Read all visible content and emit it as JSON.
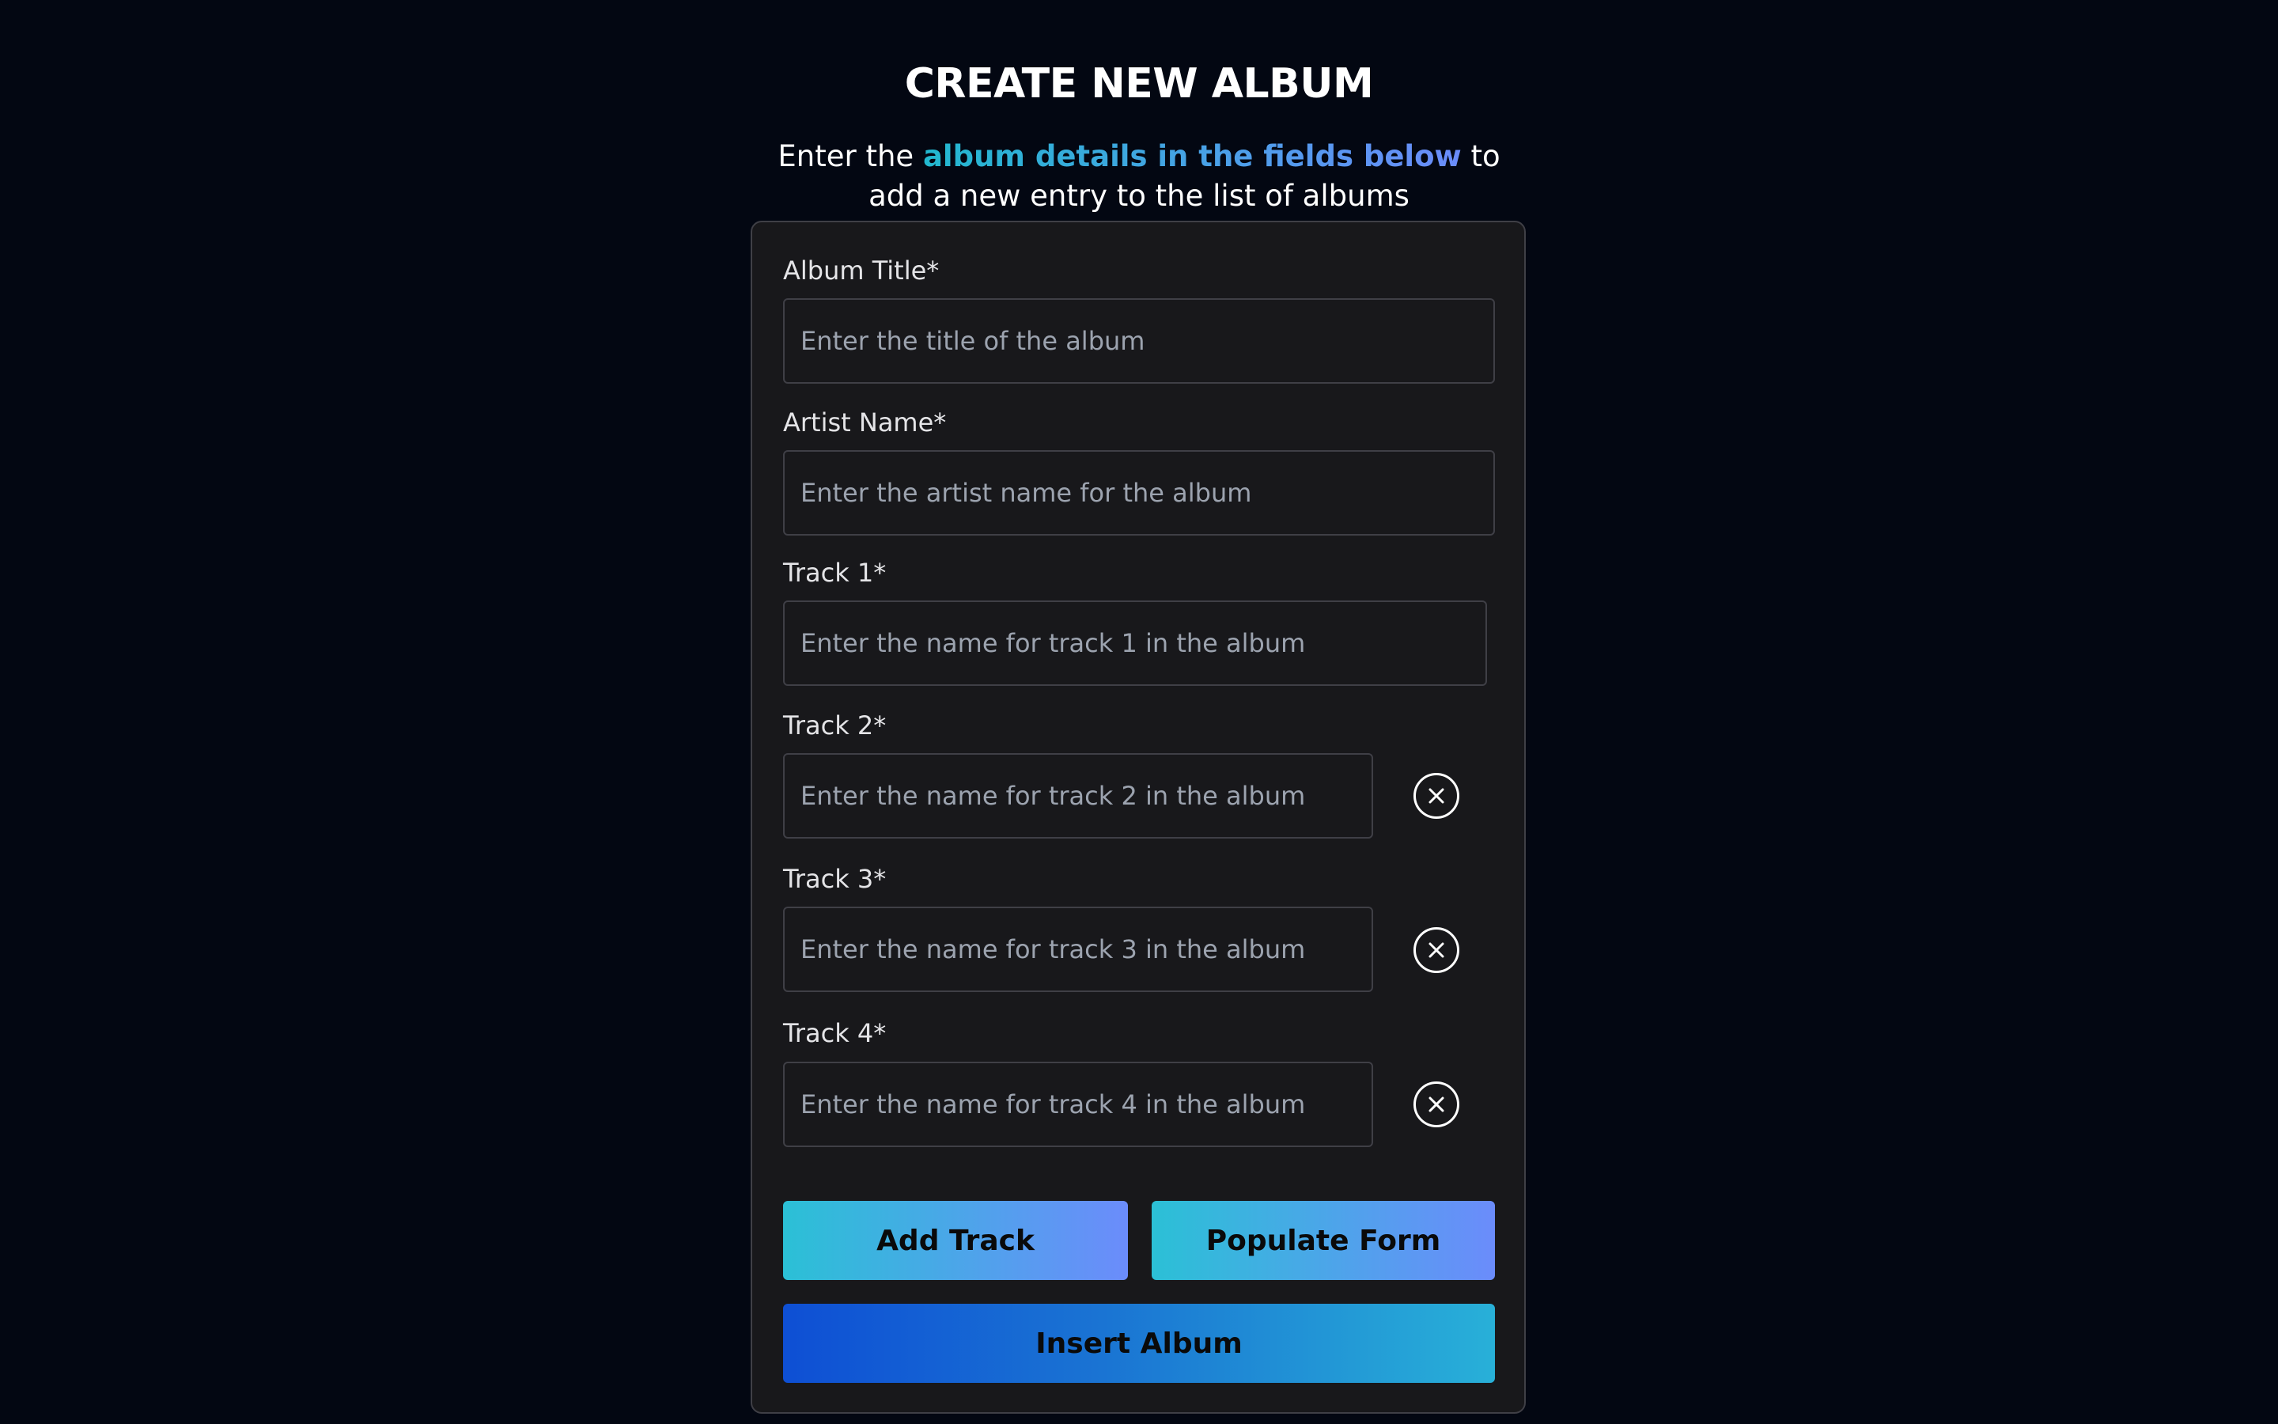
{
  "header": {
    "title": "CREATE NEW ALBUM",
    "subtitle_prefix": "Enter the ",
    "subtitle_accent": "album details in the fields below",
    "subtitle_suffix": " to add a new entry to the list of albums"
  },
  "form": {
    "album_title": {
      "label": "Album Title*",
      "placeholder": "Enter the title of the album",
      "value": ""
    },
    "artist_name": {
      "label": "Artist Name*",
      "placeholder": "Enter the artist name for the album",
      "value": ""
    },
    "tracks": [
      {
        "label": "Track 1*",
        "placeholder": "Enter the name for track 1 in the album",
        "value": "",
        "removable": false
      },
      {
        "label": "Track 2*",
        "placeholder": "Enter the name for track 2 in the album",
        "value": "",
        "removable": true,
        "remove_icon": "close-circle-icon"
      },
      {
        "label": "Track 3*",
        "placeholder": "Enter the name for track 3 in the album",
        "value": "",
        "removable": true,
        "remove_icon": "close-circle-icon"
      },
      {
        "label": "Track 4*",
        "placeholder": "Enter the name for track 4 in the album",
        "value": "",
        "removable": true,
        "remove_icon": "close-circle-icon"
      }
    ]
  },
  "actions": {
    "add_track_label": "Add Track",
    "populate_form_label": "Populate Form",
    "insert_album_label": "Insert Album"
  },
  "colors": {
    "background": "#030712",
    "card": "#18181b",
    "card_border": "#3f3f46",
    "accent_start": "#22b8cf",
    "accent_end": "#6b8cfb",
    "insert_start": "#0e4fd4",
    "insert_end": "#28b0d8"
  }
}
